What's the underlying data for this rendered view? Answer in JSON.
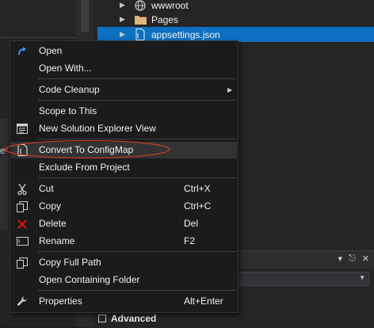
{
  "solution_explorer": {
    "items": [
      {
        "label": "wwwroot",
        "icon": "globe-icon"
      },
      {
        "label": "Pages",
        "icon": "folder-icon"
      },
      {
        "label": "appsettings.json",
        "icon": "json-file-icon",
        "selected": true
      }
    ]
  },
  "context_menu": {
    "items": [
      {
        "label": "Open",
        "icon": "open-arrow-icon",
        "shortcut": ""
      },
      {
        "label": "Open With...",
        "shortcut": ""
      },
      {
        "label": "Code Cleanup",
        "shortcut": "",
        "submenu": true
      },
      {
        "label": "Scope to This",
        "shortcut": ""
      },
      {
        "label": "New Solution Explorer View",
        "icon": "new-view-icon",
        "shortcut": ""
      },
      {
        "label": "Convert To ConfigMap",
        "icon": "configmap-icon",
        "shortcut": "",
        "highlighted": true
      },
      {
        "label": "Exclude From Project",
        "shortcut": ""
      },
      {
        "label": "Cut",
        "icon": "scissors-icon",
        "shortcut": "Ctrl+X"
      },
      {
        "label": "Copy",
        "icon": "copy-icon",
        "shortcut": "Ctrl+C"
      },
      {
        "label": "Delete",
        "icon": "delete-x-icon",
        "shortcut": "Del"
      },
      {
        "label": "Rename",
        "icon": "rename-icon",
        "shortcut": "F2"
      },
      {
        "label": "Copy Full Path",
        "icon": "copy-path-icon",
        "shortcut": ""
      },
      {
        "label": "Open Containing Folder",
        "shortcut": ""
      },
      {
        "label": "Properties",
        "icon": "wrench-icon",
        "shortcut": "Alt+Enter"
      }
    ]
  },
  "properties_panel": {
    "section_label": "Advanced"
  },
  "colors": {
    "selection": "#0e70c0",
    "menu_background": "#1b1b1c",
    "highlight_ring": "#c0392b",
    "delete_icon": "#e51400",
    "open_icon": "#3794ff"
  }
}
